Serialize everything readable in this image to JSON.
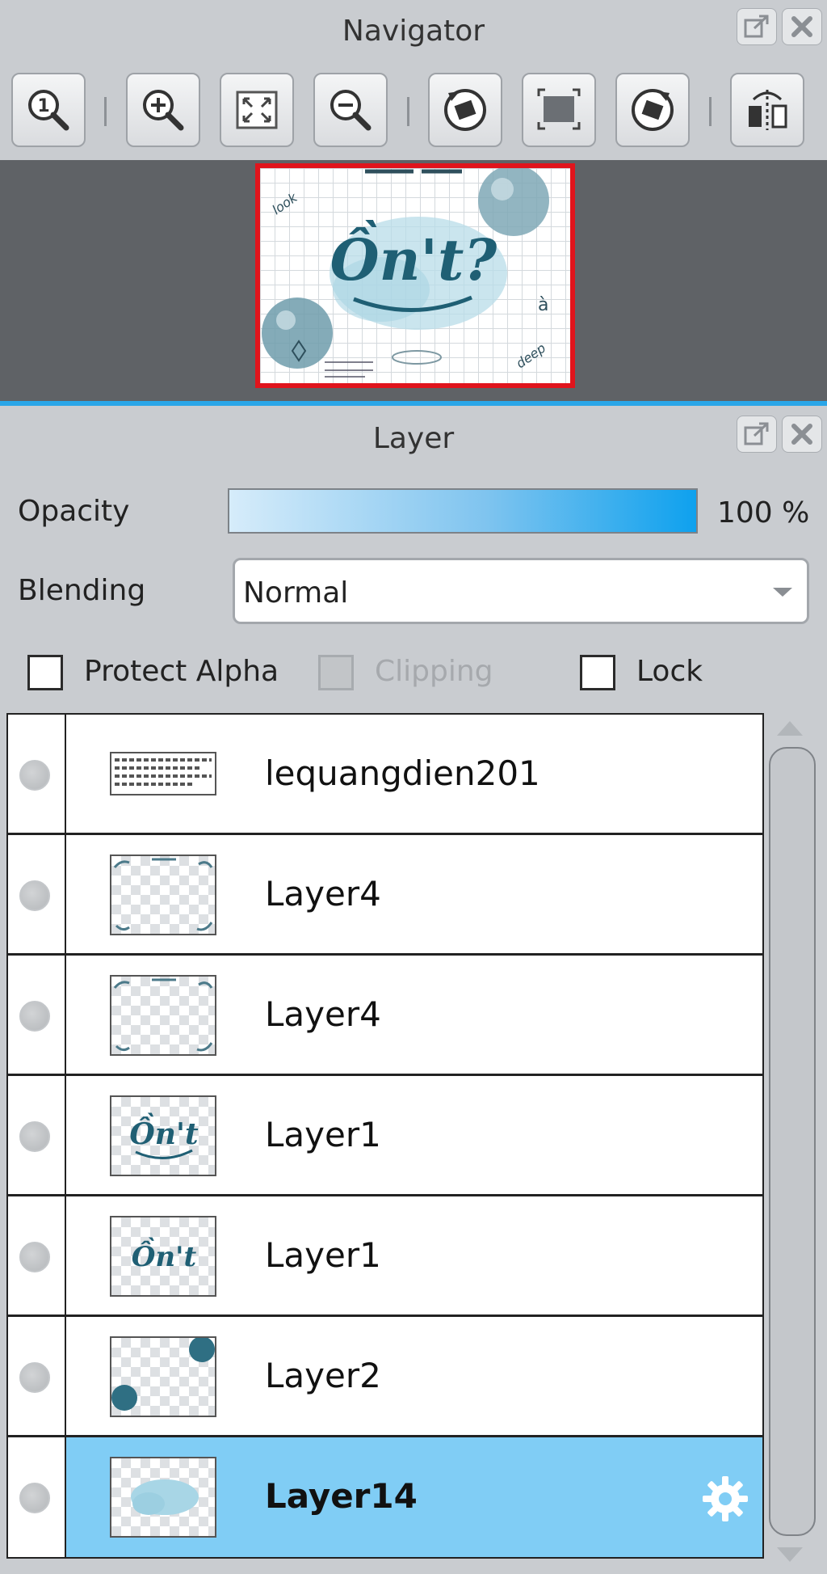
{
  "navigator": {
    "title": "Navigator",
    "toolbar": [
      {
        "name": "zoom-actual-size-button",
        "icon": "zoom-1to1-icon"
      },
      {
        "name": "zoom-in-button",
        "icon": "zoom-in-icon"
      },
      {
        "name": "fit-to-window-button",
        "icon": "fit-window-icon"
      },
      {
        "name": "zoom-out-button",
        "icon": "zoom-out-icon"
      },
      {
        "name": "rotate-left-button",
        "icon": "rotate-left-icon"
      },
      {
        "name": "reset-rotation-button",
        "icon": "reset-view-icon"
      },
      {
        "name": "rotate-right-button",
        "icon": "rotate-right-icon"
      },
      {
        "name": "flip-horizontal-button",
        "icon": "flip-horizontal-icon"
      }
    ]
  },
  "layer_panel": {
    "title": "Layer",
    "opacity_label": "Opacity",
    "opacity_value": "100 %",
    "opacity_level": 100,
    "blending_label": "Blending",
    "blending_value": "Normal",
    "protect_alpha_label": "Protect Alpha",
    "clipping_label": "Clipping",
    "lock_label": "Lock",
    "protect_alpha_checked": false,
    "clipping_checked": false,
    "clipping_enabled": false,
    "lock_checked": false,
    "layers": [
      {
        "name": "lequangdien201",
        "selected": false
      },
      {
        "name": "Layer4",
        "selected": false
      },
      {
        "name": "Layer4",
        "selected": false
      },
      {
        "name": "Layer1",
        "selected": false
      },
      {
        "name": "Layer1",
        "selected": false
      },
      {
        "name": "Layer2",
        "selected": false
      },
      {
        "name": "Layer14",
        "selected": true
      }
    ]
  },
  "colors": {
    "selection": "#80cdf5",
    "accent": "#0ea1ee",
    "navigator_frame": "#e0141c"
  }
}
